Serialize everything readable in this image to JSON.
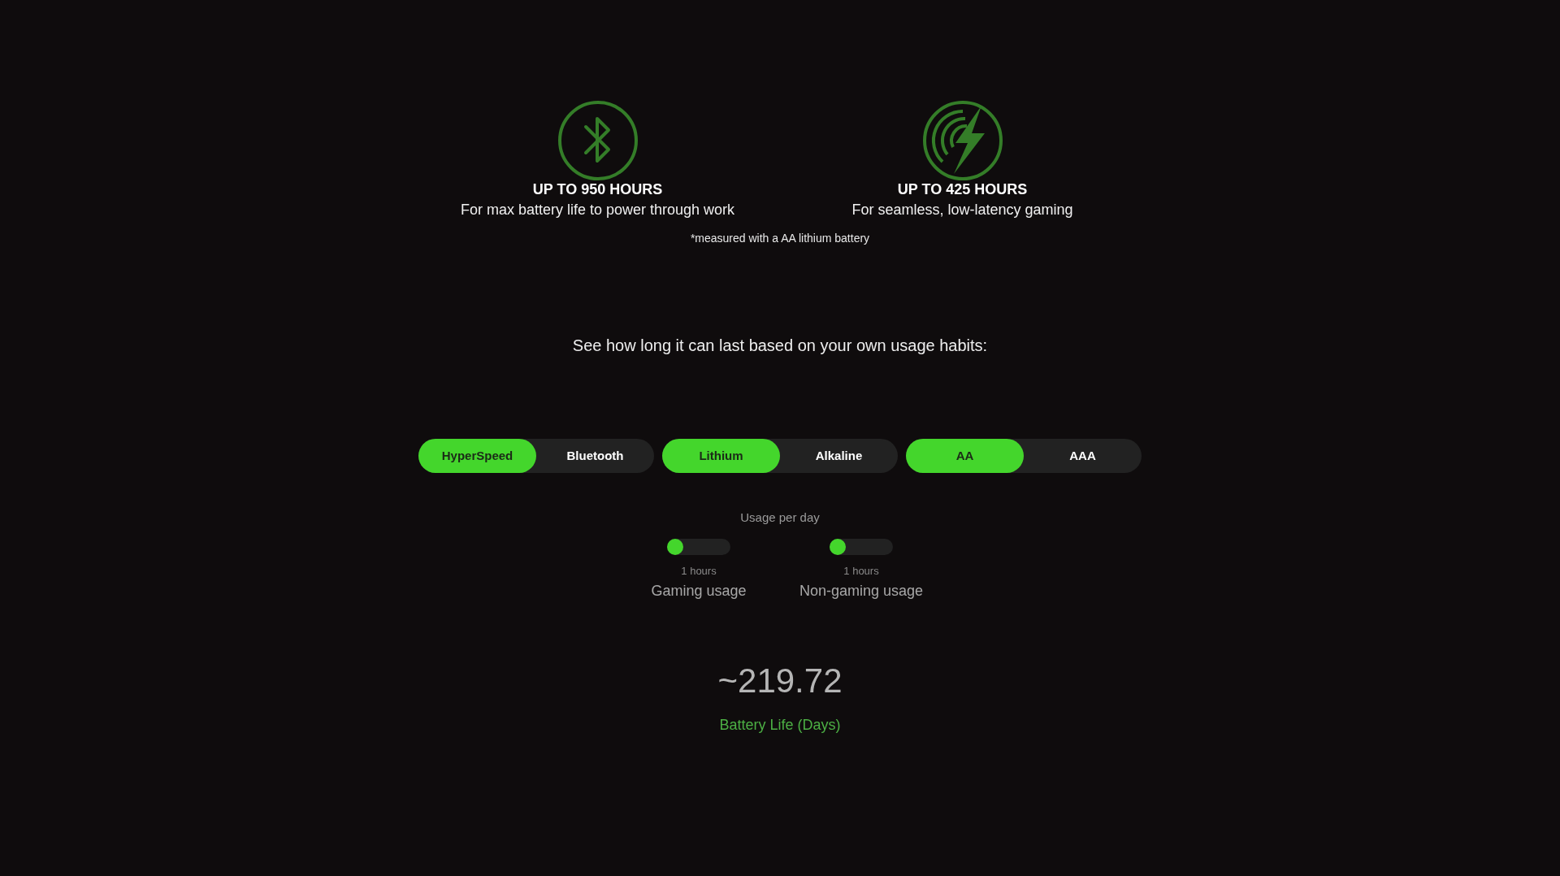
{
  "modes": [
    {
      "kind": "bluetooth",
      "heading": "UP TO 950 HOURS",
      "description": "For max battery life to power through work"
    },
    {
      "kind": "lightning",
      "heading": "UP TO 425 HOURS",
      "description": "For seamless, low-latency gaming"
    }
  ],
  "footnote": "*measured with a AA lithium battery",
  "prompt": "See how long it can last based on your own usage habits:",
  "toggle_groups": [
    {
      "options": [
        {
          "label": "HyperSpeed",
          "selected": true
        },
        {
          "label": "Bluetooth",
          "selected": false
        }
      ]
    },
    {
      "options": [
        {
          "label": "Lithium",
          "selected": true
        },
        {
          "label": "Alkaline",
          "selected": false
        }
      ]
    },
    {
      "options": [
        {
          "label": "AA",
          "selected": true
        },
        {
          "label": "AAA",
          "selected": false
        }
      ]
    }
  ],
  "usage": {
    "title": "Usage per day",
    "sliders": [
      {
        "level": 0,
        "reading": "1 hours",
        "label": "Gaming usage"
      },
      {
        "level": 0,
        "reading": "1 hours",
        "label": "Non-gaming usage"
      }
    ]
  },
  "result": {
    "value": "~219.72",
    "label": "Battery Life (Days)"
  }
}
